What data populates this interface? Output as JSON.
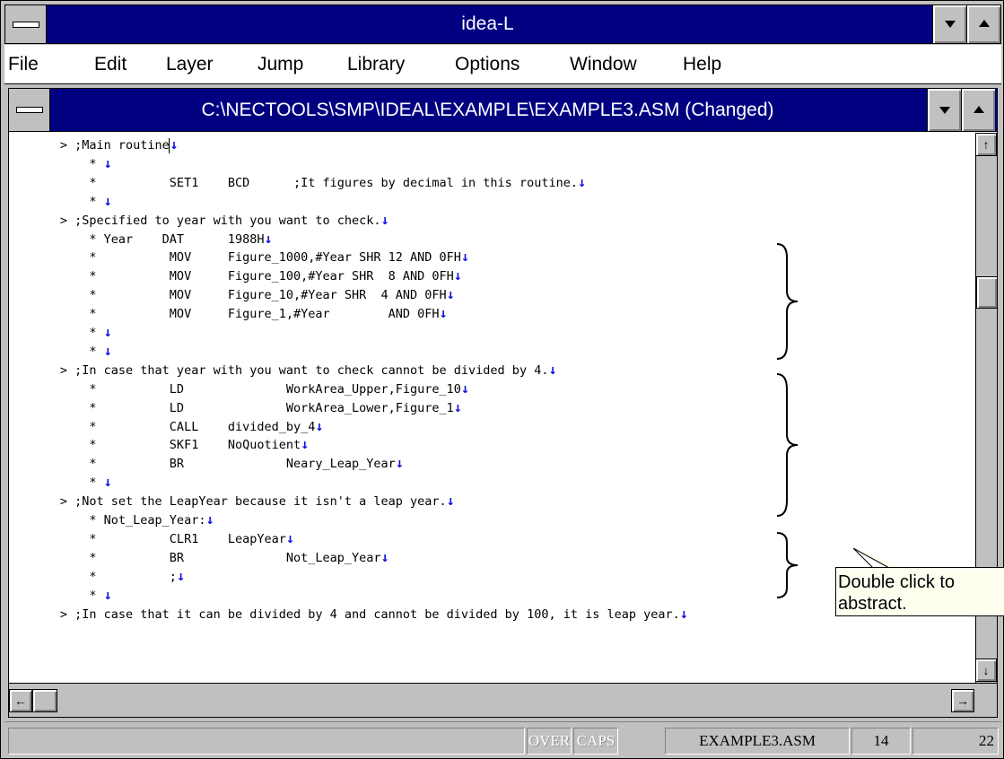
{
  "app": {
    "title": "idea-L"
  },
  "menu": [
    {
      "label": "File"
    },
    {
      "label": "Edit"
    },
    {
      "label": "Layer"
    },
    {
      "label": "Jump"
    },
    {
      "label": "Library"
    },
    {
      "label": "Options"
    },
    {
      "label": "Window"
    },
    {
      "label": "Help"
    }
  ],
  "document": {
    "title": "C:\\NECTOOLS\\SMP\\IDEAL\\EXAMPLE\\EXAMPLE3.ASM (Changed)"
  },
  "editor": {
    "newline_glyph": "↓",
    "lines": [
      "       > ;Main routine",
      "           * ",
      "           *          SET1    BCD      ;It figures by decimal in this routine.",
      "           * ",
      "       > ;Specified to year with you want to check.",
      "           * Year    DAT      1988H",
      "           *          MOV     Figure_1000,#Year SHR 12 AND 0FH",
      "           *          MOV     Figure_100,#Year SHR  8 AND 0FH",
      "           *          MOV     Figure_10,#Year SHR  4 AND 0FH",
      "           *          MOV     Figure_1,#Year        AND 0FH",
      "           * ",
      "           * ",
      "       > ;In case that year with you want to check cannot be divided by 4.",
      "           *          LD              WorkArea_Upper,Figure_10",
      "           *          LD              WorkArea_Lower,Figure_1",
      "           *          CALL    divided_by_4",
      "           *          SKF1    NoQuotient",
      "           *          BR              Neary_Leap_Year",
      "           * ",
      "       > ;Not set the LeapYear because it isn't a leap year.",
      "           * Not_Leap_Year:",
      "           *          CLR1    LeapYear",
      "           *          BR              Not_Leap_Year",
      "           *          ;",
      "           * ",
      "       > ;In case that it can be divided by 4 and cannot be divided by 100, it is leap year."
    ]
  },
  "tooltip": {
    "line1": "Double click to",
    "line2": "abstract."
  },
  "status": {
    "over": "OVER",
    "caps": "CAPS",
    "filename": "EXAMPLE3.ASM",
    "line": "14",
    "column": "22"
  }
}
